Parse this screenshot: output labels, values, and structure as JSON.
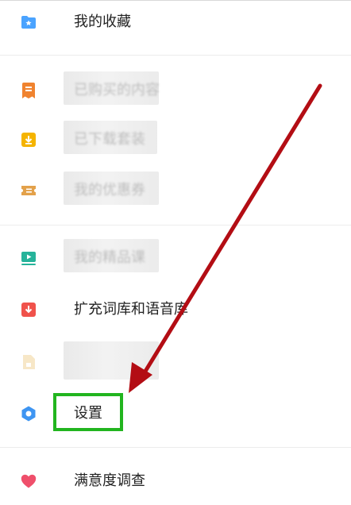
{
  "menu": {
    "favorites": {
      "label": "我的收藏"
    },
    "purchased": {
      "label": "已购买的内容"
    },
    "downloaded": {
      "label": "已下载套装"
    },
    "coupons": {
      "label": "我的优惠券"
    },
    "courses": {
      "label": "我的精品课"
    },
    "expand_lexicon": {
      "label": "扩充词库和语音库"
    },
    "hidden_item": {
      "label": ""
    },
    "settings": {
      "label": "设置"
    },
    "survey": {
      "label": "满意度调查"
    }
  },
  "colors": {
    "favorites_icon": "#4aa3ff",
    "purchased_icon": "#f0832f",
    "downloaded_icon": "#f5b400",
    "coupons_icon": "#e3a14a",
    "courses_icon": "#26b39a",
    "expand_icon": "#f0524b",
    "hidden_icon": "#f2d59a",
    "settings_icon": "#3e95f2",
    "survey_icon": "#ef4f6b",
    "highlight": "#22b51f",
    "arrow": "#b30d14"
  },
  "icons": {
    "favorites": "folder-star-icon",
    "purchased": "receipt-icon",
    "downloaded": "download-box-icon",
    "coupons": "ticket-icon",
    "courses": "video-lesson-icon",
    "expand": "download-icon",
    "hidden": "document-icon",
    "settings": "hexagon-settings-icon",
    "survey": "heart-icon"
  }
}
